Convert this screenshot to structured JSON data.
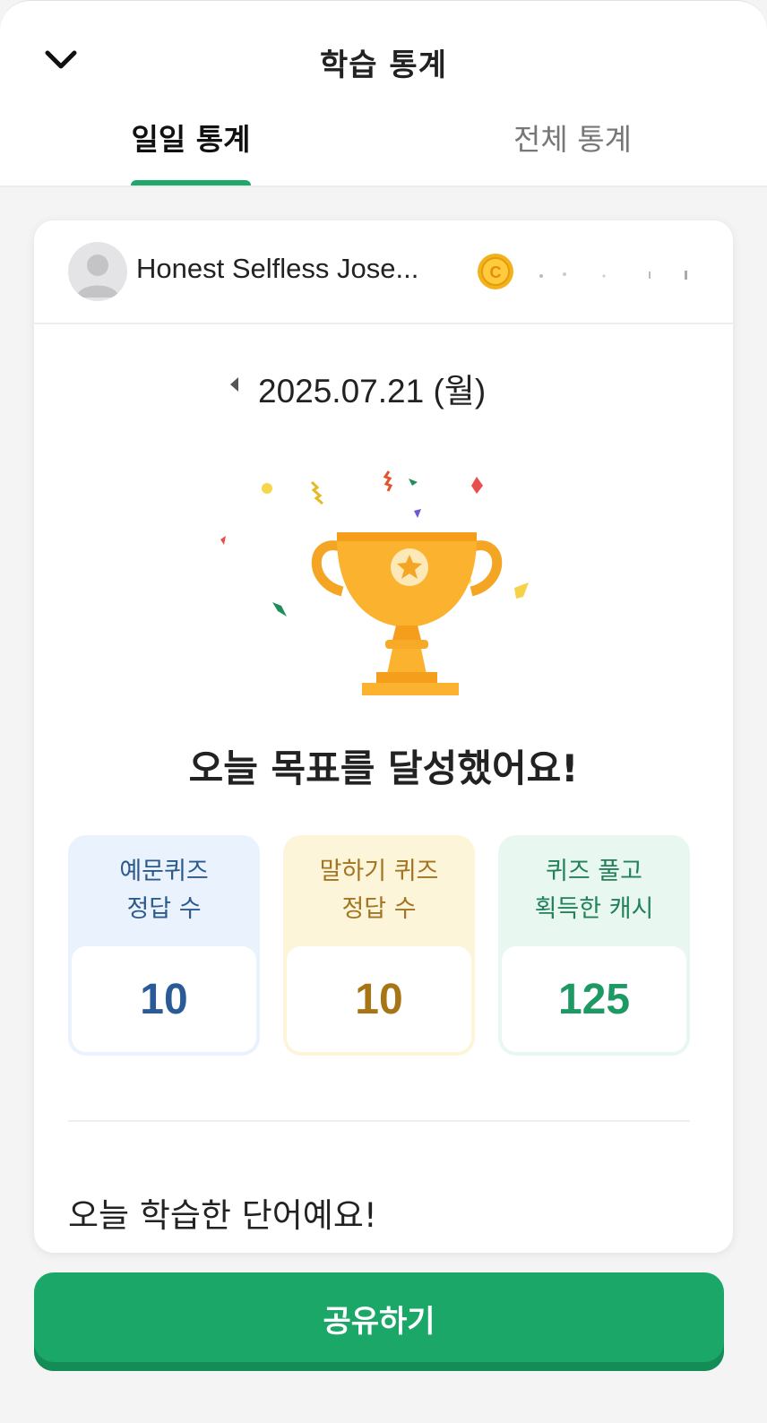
{
  "header": {
    "title": "학습 통계",
    "close_icon": "chevron-down-icon"
  },
  "tabs": [
    {
      "label": "일일 통계",
      "active": true
    },
    {
      "label": "전체 통계",
      "active": false
    }
  ],
  "colors": {
    "accent": "#1fa86a",
    "share_button": "#1aa768",
    "trophy": "#f7a928"
  },
  "profile": {
    "name": "Honest Selfless Jose...",
    "badge_icon": "coin-icon"
  },
  "date": {
    "label": "2025.07.21 (월)",
    "prev_icon": "caret-left-icon"
  },
  "achievement": {
    "icon": "trophy-icon",
    "title": "오늘 목표를 달성했어요!"
  },
  "stats": [
    {
      "line1": "예문퀴즈",
      "line2": "정답 수",
      "value": "10"
    },
    {
      "line1": "말하기 퀴즈",
      "line2": "정답 수",
      "value": "10"
    },
    {
      "line1": "퀴즈 풀고",
      "line2": "획득한 캐시",
      "value": "125"
    }
  ],
  "words_section": {
    "title": "오늘 학습한 단어예요!"
  },
  "share": {
    "label": "공유하기"
  }
}
